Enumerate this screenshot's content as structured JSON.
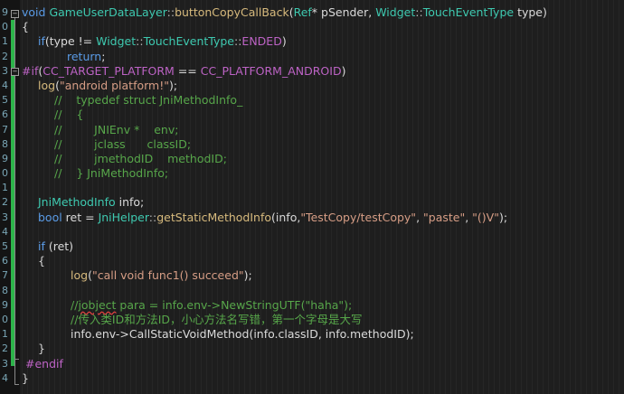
{
  "line_numbers": [
    "9",
    "0",
    "1",
    "2",
    "3",
    "4",
    "5",
    "6",
    "7",
    "8",
    "9",
    "0",
    "1",
    "2",
    "3",
    "4",
    "5",
    "6",
    "7",
    "8",
    "9",
    "0",
    "1",
    "2",
    "3",
    "4"
  ],
  "code": {
    "l1": {
      "kw": "void",
      "cls": "GameUserDataLayer",
      "sep": "::",
      "fn": "buttonCopyCallBack",
      "p1": "(",
      "t1": "Ref",
      "p2": "* pSender, ",
      "t2": "Widget",
      "sep2": "::",
      "t3": "TouchEventType",
      "p3": " type)"
    },
    "l2": "{",
    "l3": {
      "kw": "if",
      "a": "(type != ",
      "cls": "Widget",
      "s1": "::",
      "cls2": "TouchEventType",
      "s2": "::",
      "mac": "ENDED",
      "b": ")"
    },
    "l4": {
      "kw": "return",
      "b": ";"
    },
    "l5": {
      "pp": "#if",
      "a": "(",
      "mac1": "CC_TARGET_PLATFORM",
      "b": " == ",
      "mac2": "CC_PLATFORM_ANDROID",
      "c": ")"
    },
    "l6": {
      "fn": "log",
      "a": "(",
      "str": "\"android platform!\"",
      "b": ");"
    },
    "l7": "//    typedef struct JniMethodInfo_",
    "l8": "//    {",
    "l9": "//         JNIEnv *    env;",
    "l10": "//         jclass      classID;",
    "l11": "//         jmethodID    methodID;",
    "l12": "//    } JniMethodInfo;",
    "l14": {
      "cls": "JniMethodInfo",
      "b": " info;"
    },
    "l15": {
      "kw": "bool",
      "a": " ret = ",
      "cls": "JniHelper",
      "s": "::",
      "fn": "getStaticMethodInfo",
      "b": "(info,",
      "str1": "\"TestCopy/testCopy\"",
      "c": ", ",
      "str2": "\"paste\"",
      "d": ", ",
      "str3": "\"()V\"",
      "e": ");"
    },
    "l17": {
      "kw": "if",
      "a": " (ret)"
    },
    "l18": "{",
    "l19": {
      "fn": "log",
      "a": "(",
      "str": "\"call void func1() succeed\"",
      "b": ");"
    },
    "l21a": "//",
    "l21b": "jobject",
    "l21c": " para = info.env->NewStringUTF(\"haha\");",
    "l22": "//传入类ID和方法ID，小心方法名写错，第一个字母是大写",
    "l23": "info.env->CallStaticVoidMethod(info.classID, info.methodID);",
    "l24": "}",
    "l25": "#endif",
    "l26": "}"
  }
}
